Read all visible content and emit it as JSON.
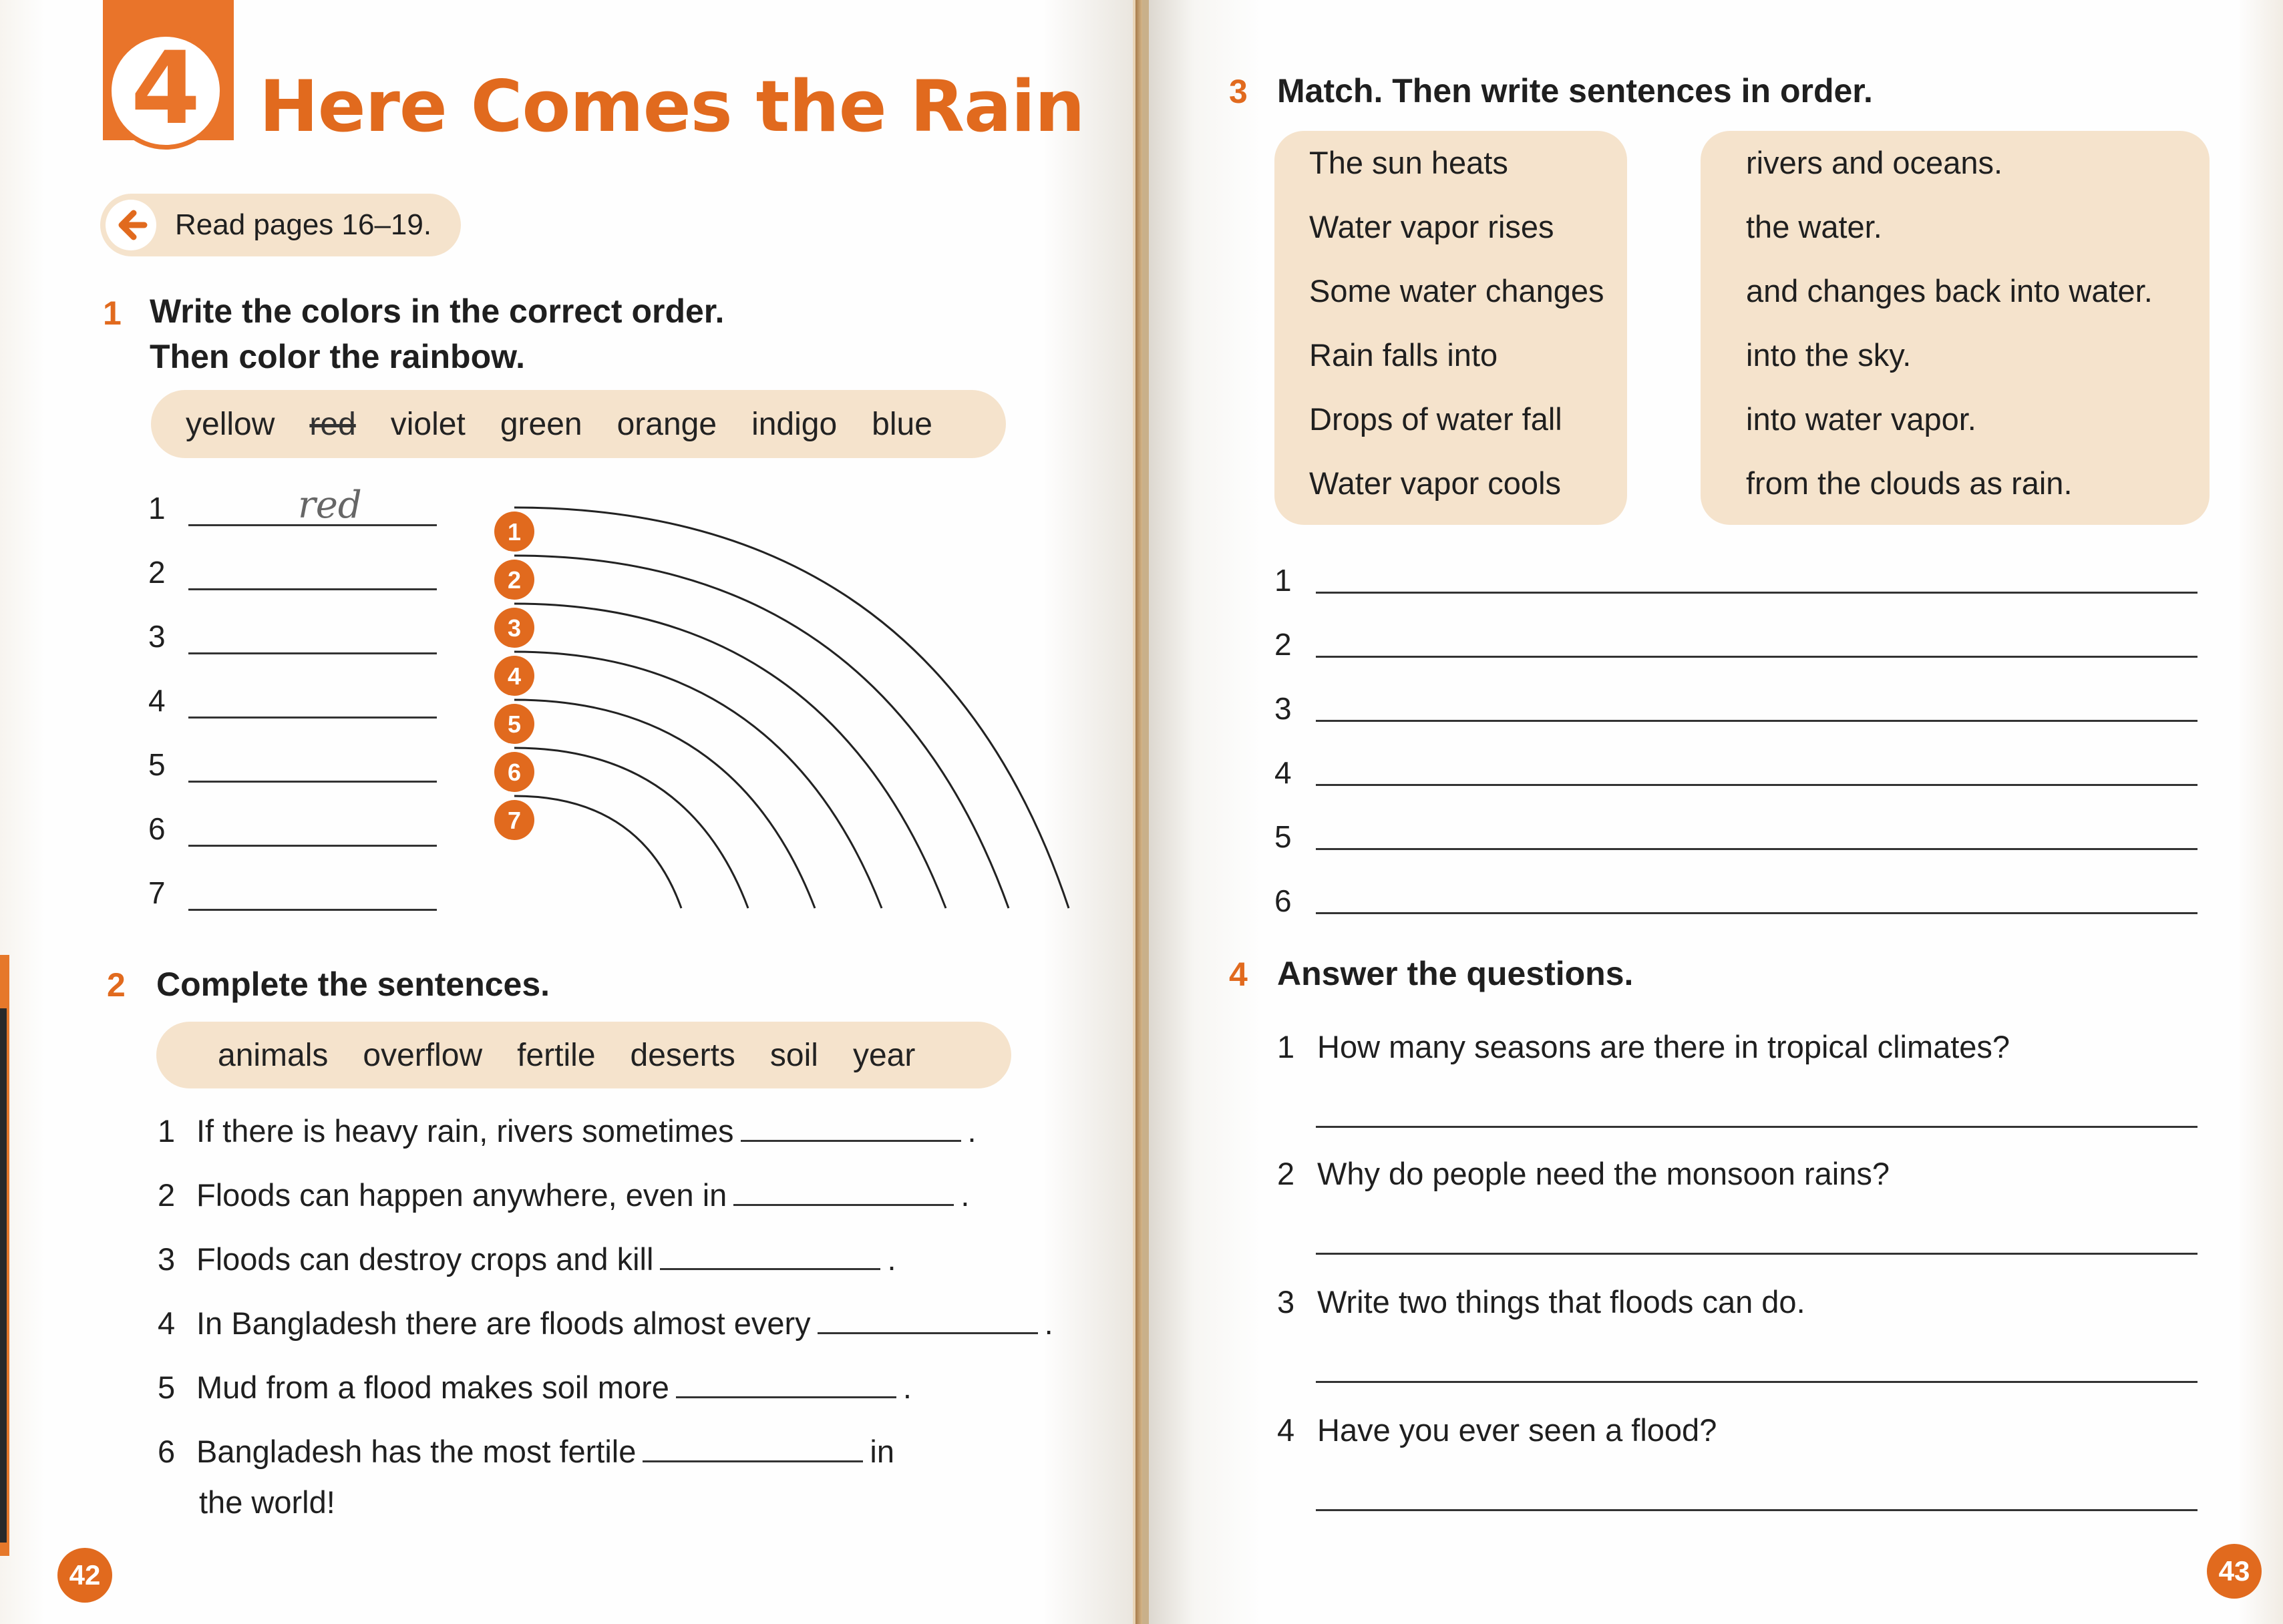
{
  "left_page": {
    "chapter_number": "4",
    "chapter_title": "Here Comes the Rain",
    "read_pages": "Read pages 16–19.",
    "section1": {
      "number": "1",
      "title_line1": "Write the colors in the correct order.",
      "title_line2": "Then color the rainbow.",
      "words": [
        "yellow",
        "red",
        "violet",
        "green",
        "orange",
        "indigo",
        "blue"
      ],
      "answer_numbers": [
        "1",
        "2",
        "3",
        "4",
        "5",
        "6",
        "7"
      ],
      "first_answer": "red",
      "rainbow_labels": [
        "1",
        "2",
        "3",
        "4",
        "5",
        "6",
        "7"
      ]
    },
    "section2": {
      "number": "2",
      "title": "Complete the sentences.",
      "words": [
        "animals",
        "overflow",
        "fertile",
        "deserts",
        "soil",
        "year"
      ],
      "sentences": [
        {
          "n": "1",
          "text": "If there is heavy rain, rivers sometimes",
          "end": "."
        },
        {
          "n": "2",
          "text": "Floods can happen anywhere, even in",
          "end": "."
        },
        {
          "n": "3",
          "text": "Floods can destroy crops and kill",
          "end": "."
        },
        {
          "n": "4",
          "text": "In Bangladesh there are floods almost every",
          "end": "."
        },
        {
          "n": "5",
          "text": "Mud from a flood makes soil more",
          "end": "."
        },
        {
          "n": "6",
          "text": "Bangladesh has the most fertile",
          "end": "in",
          "line2": "the world!"
        }
      ]
    },
    "page_number": "42"
  },
  "right_page": {
    "section3": {
      "number": "3",
      "title": "Match. Then write sentences in order.",
      "left_column": [
        "The sun heats",
        "Water vapor rises",
        "Some water changes",
        "Rain falls into",
        "Drops of water fall",
        "Water vapor cools"
      ],
      "right_column": [
        "rivers and oceans.",
        "the water.",
        "and changes back into water.",
        "into the sky.",
        "into water vapor.",
        "from the clouds as rain."
      ],
      "line_numbers": [
        "1",
        "2",
        "3",
        "4",
        "5",
        "6"
      ]
    },
    "section4": {
      "number": "4",
      "title": "Answer the questions.",
      "questions": [
        {
          "n": "1",
          "text": "How many seasons are there in tropical climates?"
        },
        {
          "n": "2",
          "text": "Why do people need the monsoon rains?"
        },
        {
          "n": "3",
          "text": "Write two things that floods can do."
        },
        {
          "n": "4",
          "text": "Have you ever seen a flood?"
        }
      ]
    },
    "page_number": "43"
  },
  "colors": {
    "accent_orange": "#e16a1e",
    "box_beige": "#f5e3cc"
  }
}
